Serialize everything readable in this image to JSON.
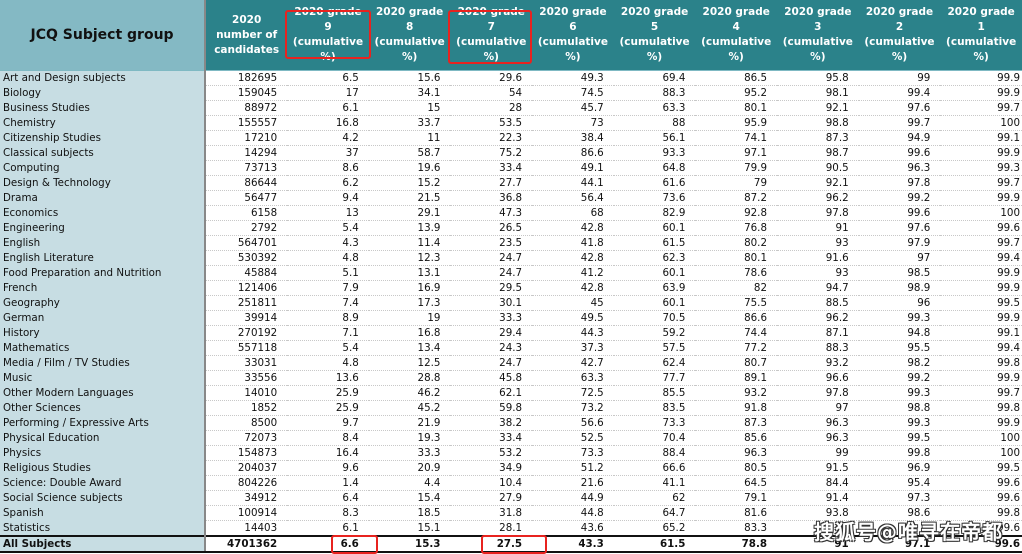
{
  "table": {
    "headers": [
      "JCQ Subject group",
      "2020 number of candidates",
      "2020 grade 9 (cumulative %)",
      "2020 grade 8 (cumulative %)",
      "2020 grade 7 (cumulative %)",
      "2020 grade 6 (cumulative %)",
      "2020 grade 5 (cumulative %)",
      "2020 grade 4 (cumulative %)",
      "2020 grade 3 (cumulative %)",
      "2020 grade 2 (cumulative %)",
      "2020 grade 1 (cumulative %)"
    ],
    "rows": [
      [
        "Art and Design subjects",
        "182695",
        "6.5",
        "15.6",
        "29.6",
        "49.3",
        "69.4",
        "86.5",
        "95.8",
        "99",
        "99.9"
      ],
      [
        "Biology",
        "159045",
        "17",
        "34.1",
        "54",
        "74.5",
        "88.3",
        "95.2",
        "98.1",
        "99.4",
        "99.9"
      ],
      [
        "Business Studies",
        "88972",
        "6.1",
        "15",
        "28",
        "45.7",
        "63.3",
        "80.1",
        "92.1",
        "97.6",
        "99.7"
      ],
      [
        "Chemistry",
        "155557",
        "16.8",
        "33.7",
        "53.5",
        "73",
        "88",
        "95.9",
        "98.8",
        "99.7",
        "100"
      ],
      [
        "Citizenship Studies",
        "17210",
        "4.2",
        "11",
        "22.3",
        "38.4",
        "56.1",
        "74.1",
        "87.3",
        "94.9",
        "99.1"
      ],
      [
        "Classical subjects",
        "14294",
        "37",
        "58.7",
        "75.2",
        "86.6",
        "93.3",
        "97.1",
        "98.7",
        "99.6",
        "99.9"
      ],
      [
        "Computing",
        "73713",
        "8.6",
        "19.6",
        "33.4",
        "49.1",
        "64.8",
        "79.9",
        "90.5",
        "96.3",
        "99.3"
      ],
      [
        "Design & Technology",
        "86644",
        "6.2",
        "15.2",
        "27.7",
        "44.1",
        "61.6",
        "79",
        "92.1",
        "97.8",
        "99.7"
      ],
      [
        "Drama",
        "56477",
        "9.4",
        "21.5",
        "36.8",
        "56.4",
        "73.6",
        "87.2",
        "96.2",
        "99.2",
        "99.9"
      ],
      [
        "Economics",
        "6158",
        "13",
        "29.1",
        "47.3",
        "68",
        "82.9",
        "92.8",
        "97.8",
        "99.6",
        "100"
      ],
      [
        "Engineering",
        "2792",
        "5.4",
        "13.9",
        "26.5",
        "42.8",
        "60.1",
        "76.8",
        "91",
        "97.6",
        "99.6"
      ],
      [
        "English",
        "564701",
        "4.3",
        "11.4",
        "23.5",
        "41.8",
        "61.5",
        "80.2",
        "93",
        "97.9",
        "99.7"
      ],
      [
        "English Literature",
        "530392",
        "4.8",
        "12.3",
        "24.7",
        "42.8",
        "62.3",
        "80.1",
        "91.6",
        "97",
        "99.4"
      ],
      [
        "Food Preparation and Nutrition",
        "45884",
        "5.1",
        "13.1",
        "24.7",
        "41.2",
        "60.1",
        "78.6",
        "93",
        "98.5",
        "99.9"
      ],
      [
        "French",
        "121406",
        "7.9",
        "16.9",
        "29.5",
        "42.8",
        "63.9",
        "82",
        "94.7",
        "98.9",
        "99.9"
      ],
      [
        "Geography",
        "251811",
        "7.4",
        "17.3",
        "30.1",
        "45",
        "60.1",
        "75.5",
        "88.5",
        "96",
        "99.5"
      ],
      [
        "German",
        "39914",
        "8.9",
        "19",
        "33.3",
        "49.5",
        "70.5",
        "86.6",
        "96.2",
        "99.3",
        "99.9"
      ],
      [
        "History",
        "270192",
        "7.1",
        "16.8",
        "29.4",
        "44.3",
        "59.2",
        "74.4",
        "87.1",
        "94.8",
        "99.1"
      ],
      [
        "Mathematics",
        "557118",
        "5.4",
        "13.4",
        "24.3",
        "37.3",
        "57.5",
        "77.2",
        "88.3",
        "95.5",
        "99.4"
      ],
      [
        "Media / Film / TV Studies",
        "33031",
        "4.8",
        "12.5",
        "24.7",
        "42.7",
        "62.4",
        "80.7",
        "93.2",
        "98.2",
        "99.8"
      ],
      [
        "Music",
        "33556",
        "13.6",
        "28.8",
        "45.8",
        "63.3",
        "77.7",
        "89.1",
        "96.6",
        "99.2",
        "99.9"
      ],
      [
        "Other Modern Languages",
        "14010",
        "25.9",
        "46.2",
        "62.1",
        "72.5",
        "85.5",
        "93.2",
        "97.8",
        "99.3",
        "99.7"
      ],
      [
        "Other Sciences",
        "1852",
        "25.9",
        "45.2",
        "59.8",
        "73.2",
        "83.5",
        "91.8",
        "97",
        "98.8",
        "99.8"
      ],
      [
        "Performing / Expressive Arts",
        "8500",
        "9.7",
        "21.9",
        "38.2",
        "56.6",
        "73.3",
        "87.3",
        "96.3",
        "99.3",
        "99.9"
      ],
      [
        "Physical Education",
        "72073",
        "8.4",
        "19.3",
        "33.4",
        "52.5",
        "70.4",
        "85.6",
        "96.3",
        "99.5",
        "100"
      ],
      [
        "Physics",
        "154873",
        "16.4",
        "33.3",
        "53.2",
        "73.3",
        "88.4",
        "96.3",
        "99",
        "99.8",
        "100"
      ],
      [
        "Religious Studies",
        "204037",
        "9.6",
        "20.9",
        "34.9",
        "51.2",
        "66.6",
        "80.5",
        "91.5",
        "96.9",
        "99.5"
      ],
      [
        "Science: Double Award",
        "804226",
        "1.4",
        "4.4",
        "10.4",
        "21.6",
        "41.1",
        "64.5",
        "84.4",
        "95.4",
        "99.6"
      ],
      [
        "Social Science subjects",
        "34912",
        "6.4",
        "15.4",
        "27.9",
        "44.9",
        "62",
        "79.1",
        "91.4",
        "97.3",
        "99.6"
      ],
      [
        "Spanish",
        "100914",
        "8.3",
        "18.5",
        "31.8",
        "44.8",
        "64.7",
        "81.6",
        "93.8",
        "98.6",
        "99.8"
      ],
      [
        "Statistics",
        "14403",
        "6.1",
        "15.1",
        "28.1",
        "43.6",
        "65.2",
        "83.3",
        "",
        "",
        "99.6"
      ]
    ],
    "total": [
      "All Subjects",
      "4701362",
      "6.6",
      "15.3",
      "27.5",
      "43.3",
      "61.5",
      "78.8",
      "91",
      "97.1",
      "99.6"
    ]
  },
  "watermark": "搜狐号@唯寻在帝都",
  "colors": {
    "header_bg": "#2b828a",
    "subject_header_bg": "#84b9c4",
    "subject_col_bg": "#c7dde3",
    "highlight": "#e8231f"
  }
}
